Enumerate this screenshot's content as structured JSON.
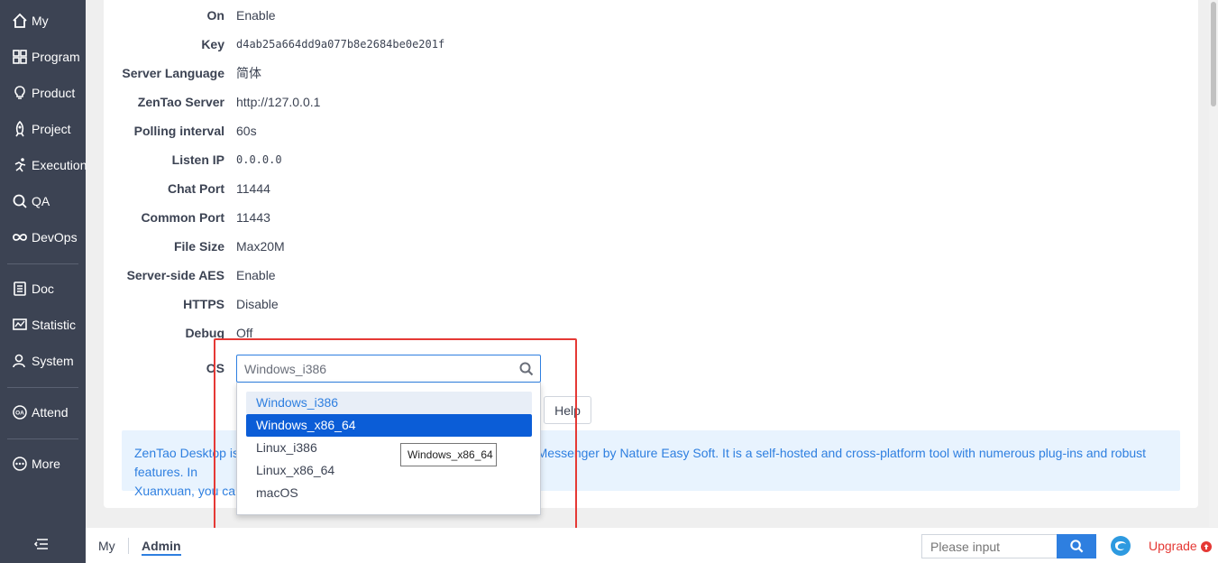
{
  "sidebar": {
    "items": [
      {
        "label": "My",
        "icon": "home-icon"
      },
      {
        "label": "Program",
        "icon": "grid-icon"
      },
      {
        "label": "Product",
        "icon": "lightbulb-icon"
      },
      {
        "label": "Project",
        "icon": "rocket-icon"
      },
      {
        "label": "Execution",
        "icon": "run-icon"
      },
      {
        "label": "QA",
        "icon": "search-check-icon"
      },
      {
        "label": "DevOps",
        "icon": "infinity-icon"
      },
      {
        "label": "Doc",
        "icon": "document-icon"
      },
      {
        "label": "Statistic",
        "icon": "chart-icon"
      },
      {
        "label": "System",
        "icon": "users-icon"
      },
      {
        "label": "Attend",
        "icon": "oa-icon"
      },
      {
        "label": "More",
        "icon": "more-icon"
      }
    ]
  },
  "settings": {
    "rows": [
      {
        "label": "On",
        "value": "Enable"
      },
      {
        "label": "Key",
        "value": "d4ab25a664dd9a077b8e2684be0e201f"
      },
      {
        "label": "Server Language",
        "value": "简体"
      },
      {
        "label": "ZenTao Server",
        "value": "http://127.0.0.1"
      },
      {
        "label": "Polling interval",
        "value": "60s"
      },
      {
        "label": "Listen IP",
        "value": "0.0.0.0"
      },
      {
        "label": "Chat Port",
        "value": "11444"
      },
      {
        "label": "Common Port",
        "value": "11443"
      },
      {
        "label": "File Size",
        "value": "Max20M"
      },
      {
        "label": "Server-side AES",
        "value": "Enable"
      },
      {
        "label": "HTTPS",
        "value": "Disable"
      },
      {
        "label": "Debug",
        "value": "Off"
      }
    ],
    "os_label": "OS",
    "os_selected": "Windows_i386",
    "os_options": [
      "Windows_i386",
      "Windows_x86_64",
      "Linux_i386",
      "Linux_x86_64",
      "macOS"
    ],
    "help_label": "Help",
    "tooltip": "Windows_x86_64",
    "info_text_line1_left": "ZenTao Desktop is p",
    "info_text_line1_right": "Messenger by Nature Easy Soft. It is a self-hosted and cross-platform tool with numerous plug-ins and robust features. In",
    "info_text_line2": "Xuanxuan, you can"
  },
  "footer": {
    "my": "My",
    "admin": "Admin",
    "search_placeholder": "Please input",
    "upgrade": "Upgrade"
  },
  "colors": {
    "sidebar_bg": "#3c4353",
    "accent": "#2e7fe0",
    "active_option": "#0b5dd7",
    "highlight_box": "#e53935"
  }
}
